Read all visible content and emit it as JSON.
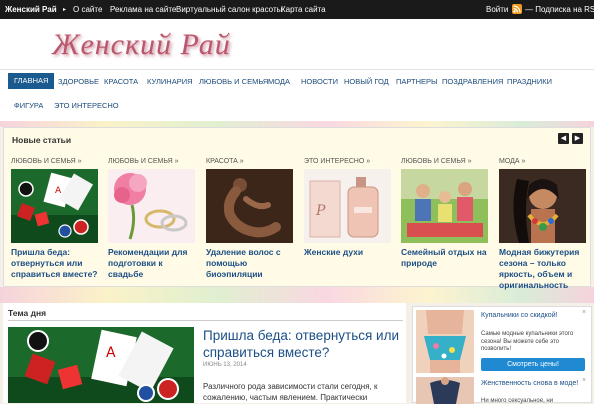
{
  "topbar": {
    "site": "Женский Рай",
    "links": [
      "О сайте",
      "Реклама на сайте",
      "Виртуальный салон красоты",
      "Карта сайта"
    ],
    "login": "Войти",
    "rss": "— Подписка на RSS"
  },
  "logo": {
    "text": "Женский Рай"
  },
  "nav": {
    "row1": [
      "ГЛАВНАЯ",
      "ЗДОРОВЬЕ",
      "КРАСОТА",
      "КУЛИНАРИЯ",
      "ЛЮБОВЬ И СЕМЬЯ",
      "МОДА",
      "НОВОСТИ",
      "НОВЫЙ ГОД",
      "ПАРТНЕРЫ",
      "ПОЗДРАВЛЕНИЯ",
      "ПРАЗДНИКИ"
    ],
    "row2": [
      "ФИГУРА",
      "ЭТО ИНТЕРЕСНО"
    ]
  },
  "new_articles": {
    "title": "Новые статьи",
    "prev": "◀",
    "next": "▶",
    "items": [
      {
        "category": "ЛЮБОВЬ И СЕМЬЯ »",
        "title": "Пришла беда: отвернуться или справиться вместе?"
      },
      {
        "category": "ЛЮБОВЬ И СЕМЬЯ »",
        "title": "Рекомендации для подготовки к свадьбе"
      },
      {
        "category": "КРАСОТА »",
        "title": "Удаление волос с помощью биоэпиляции"
      },
      {
        "category": "ЭТО ИНТЕРЕСНО »",
        "title": "Женские духи"
      },
      {
        "category": "ЛЮБОВЬ И СЕМЬЯ »",
        "title": "Семейный отдых на природе"
      },
      {
        "category": "МОДА »",
        "title": "Модная бижутерия сезона – только яркость, объем и оригинальность"
      }
    ]
  },
  "topic_of_day": {
    "section": "Тема дня",
    "title": "Пришла беда: отвернуться или справиться вместе?",
    "date": "ИЮНЬ 13, 2014",
    "excerpt": "Различного рода зависимости стали сегодня, к сожалению, частым явлением. Практически"
  },
  "sidebar": {
    "ad1": {
      "title": "Купальники со скидкой!",
      "text": "Самые модные купальники этого сезона! Вы можете себе это позволить!",
      "button": "Смотреть цены!",
      "close": "×"
    },
    "ad2": {
      "title": "Женственность снова в моде!",
      "text": "Ни много сексуальное, ни"
    }
  },
  "colors": {
    "accent": "#1b5a8e",
    "link": "#1c4f86",
    "topbar": "#1a1a1a",
    "logo": "#b9586c",
    "button": "#1f8ad2"
  }
}
